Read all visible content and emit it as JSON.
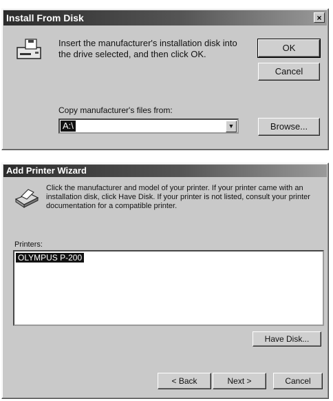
{
  "install_dialog": {
    "title": "Install From Disk",
    "close_glyph": "×",
    "message_line1": "Insert the manufacturer's installation disk into",
    "message_line2": "the drive selected, and then click OK.",
    "copy_label": "Copy manufacturer's files from:",
    "path_value": "A:\\",
    "ok_label": "OK",
    "cancel_label": "Cancel",
    "browse_label": "Browse...",
    "icon": "floppy-drive-icon"
  },
  "wizard_dialog": {
    "title": "Add Printer Wizard",
    "message_line1": "Click the manufacturer and model of your printer. If your printer came with an",
    "message_line2": "installation disk, click Have Disk. If your printer is not listed, consult your printer",
    "message_line3": "documentation for a compatible printer.",
    "printers_label": "Printers:",
    "printers": [
      "OLYMPUS P-200"
    ],
    "have_disk_label": "Have Disk...",
    "back_label": "< Back",
    "next_label": "Next >",
    "cancel_label": "Cancel",
    "icon": "printer-icon"
  }
}
